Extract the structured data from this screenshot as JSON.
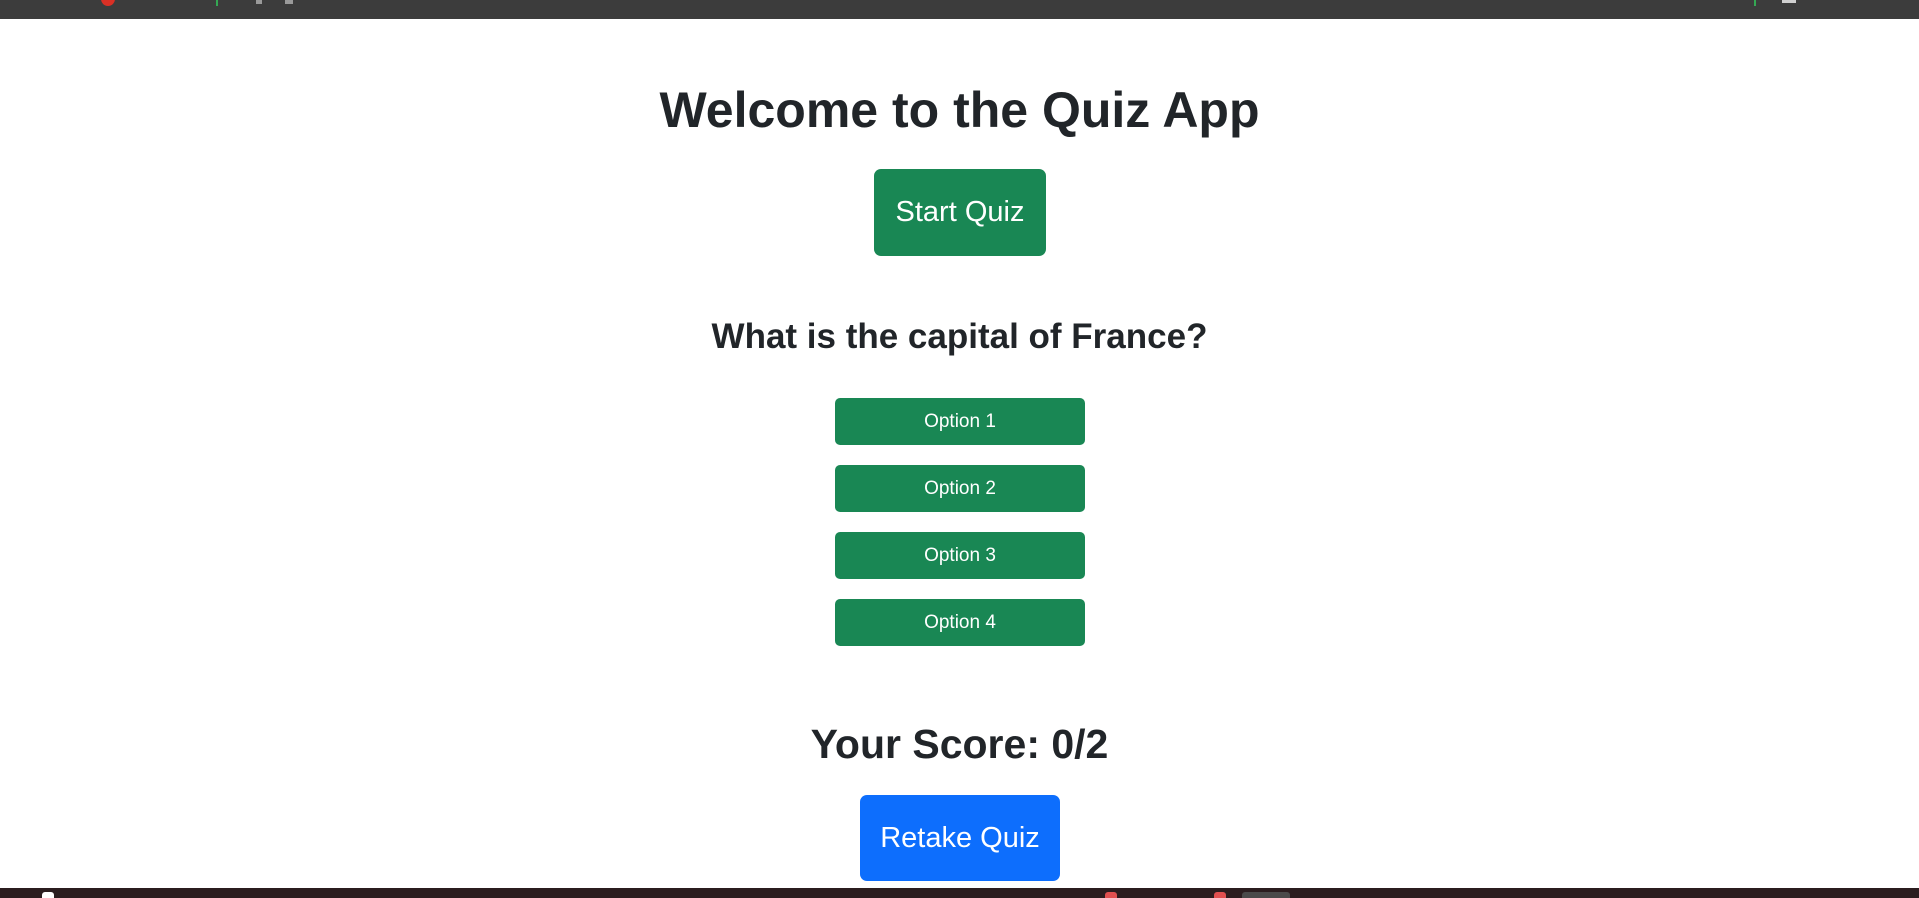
{
  "app": {
    "title": "Welcome to the Quiz App",
    "start_button": "Start Quiz"
  },
  "quiz": {
    "question": "What is the capital of France?",
    "options": [
      "Option 1",
      "Option 2",
      "Option 3",
      "Option 4"
    ]
  },
  "result": {
    "score_text": "Your Score: 0/2",
    "retake_button": "Retake Quiz"
  },
  "colors": {
    "success": "#198754",
    "primary": "#0d6efd",
    "text": "#212529",
    "top_bar": "#3c3c3c",
    "taskbar": "#2b1d1f"
  }
}
